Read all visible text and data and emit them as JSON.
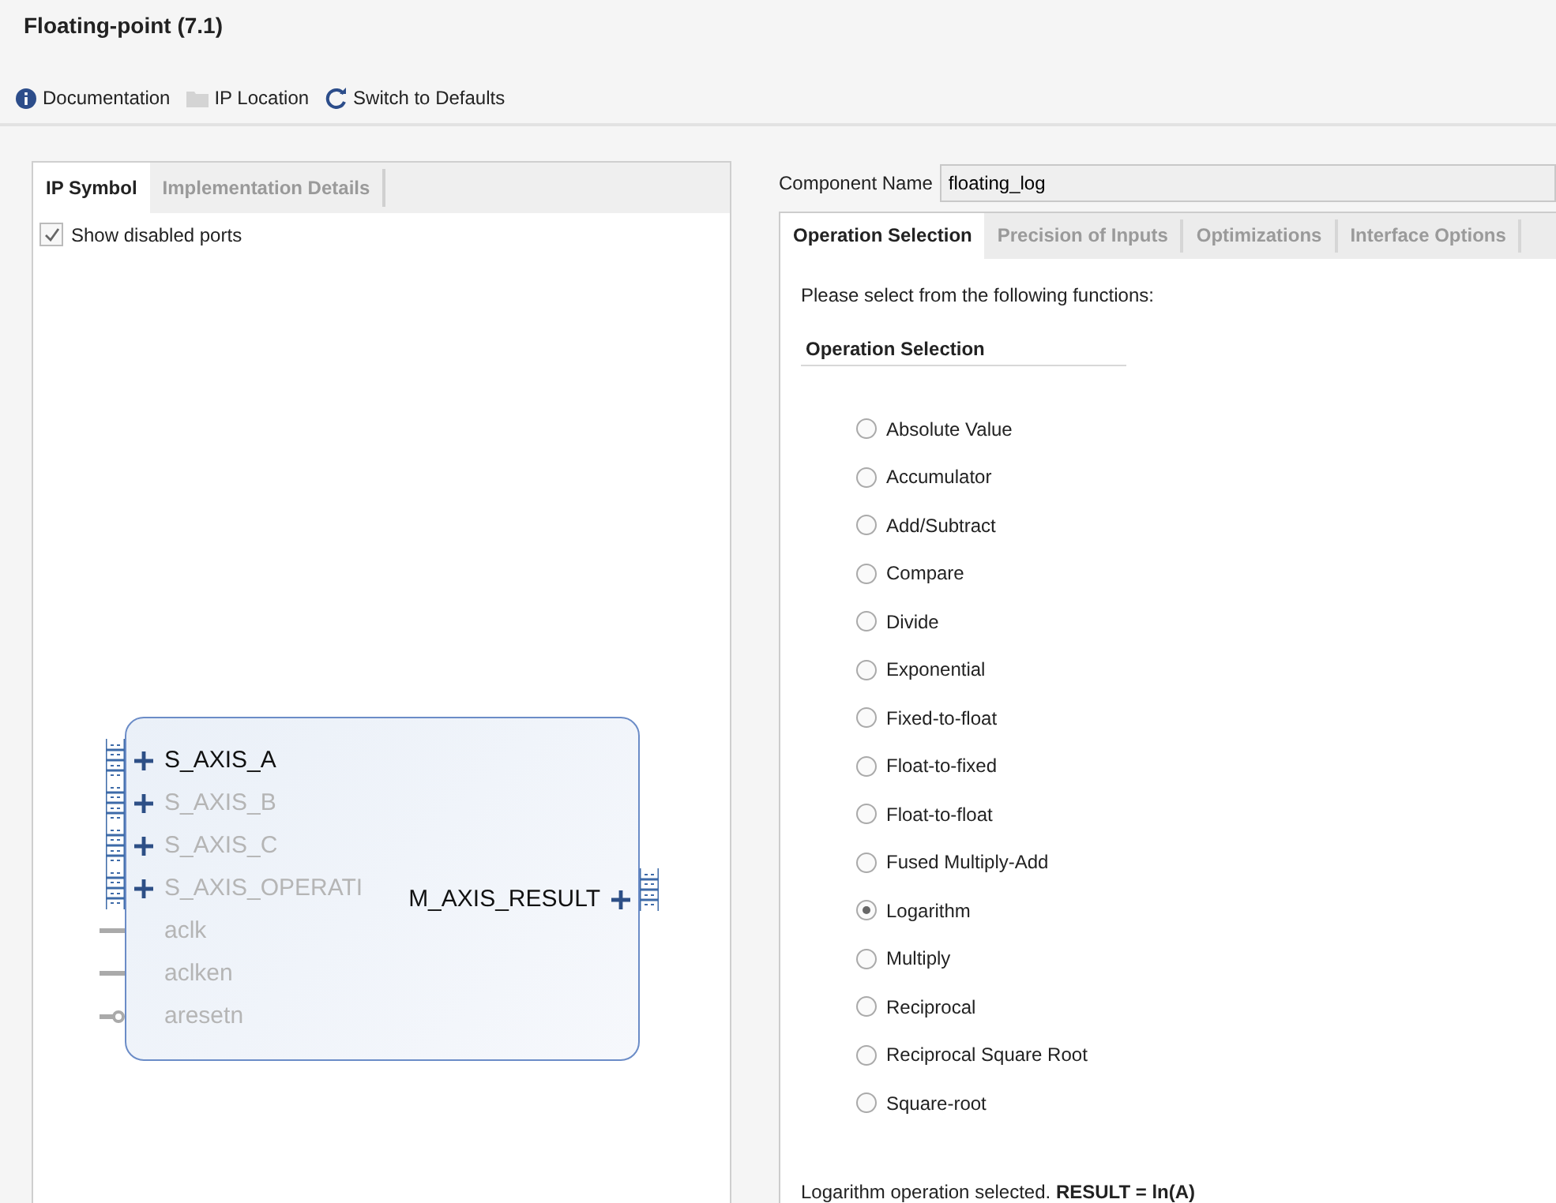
{
  "window": {
    "title": "Floating-point (7.1)"
  },
  "toolbar": [
    {
      "label": "Documentation",
      "kind": "info"
    },
    {
      "label": "IP Location",
      "kind": "folder"
    },
    {
      "label": "Switch to Defaults",
      "kind": "refresh"
    }
  ],
  "left_panel": {
    "tabs": [
      {
        "label": "IP Symbol",
        "selected": true
      },
      {
        "label": "Implementation Details",
        "selected": false
      }
    ],
    "show_disabled_ports": {
      "label": "Show disabled ports",
      "checked": true
    },
    "symbol": {
      "left_ports": [
        {
          "name": "S_AXIS_A",
          "kind": "bus",
          "disabled": false
        },
        {
          "name": "S_AXIS_B",
          "kind": "bus",
          "disabled": true
        },
        {
          "name": "S_AXIS_C",
          "kind": "bus",
          "disabled": true
        },
        {
          "name": "S_AXIS_OPERATI",
          "kind": "bus",
          "disabled": true
        },
        {
          "name": "aclk",
          "kind": "clock",
          "disabled": true
        },
        {
          "name": "aclken",
          "kind": "clock",
          "disabled": true
        },
        {
          "name": "aresetn",
          "kind": "reset",
          "disabled": true
        }
      ],
      "right_ports": [
        {
          "name": "M_AXIS_RESULT",
          "kind": "bus",
          "disabled": false
        }
      ]
    }
  },
  "component_name": {
    "label": "Component Name",
    "value": "floating_log"
  },
  "tabs": [
    {
      "label": "Operation Selection",
      "selected": true
    },
    {
      "label": "Precision of Inputs",
      "selected": false
    },
    {
      "label": "Optimizations",
      "selected": false
    },
    {
      "label": "Interface Options",
      "selected": false
    }
  ],
  "intro": "Please select from the following functions:",
  "section_title": "Operation Selection",
  "operations": [
    {
      "label": "Absolute Value",
      "selected": false
    },
    {
      "label": "Accumulator",
      "selected": false
    },
    {
      "label": "Add/Subtract",
      "selected": false
    },
    {
      "label": "Compare",
      "selected": false
    },
    {
      "label": "Divide",
      "selected": false
    },
    {
      "label": "Exponential",
      "selected": false
    },
    {
      "label": "Fixed-to-float",
      "selected": false
    },
    {
      "label": "Float-to-fixed",
      "selected": false
    },
    {
      "label": "Float-to-float",
      "selected": false
    },
    {
      "label": "Fused Multiply-Add",
      "selected": false
    },
    {
      "label": "Logarithm",
      "selected": true
    },
    {
      "label": "Multiply",
      "selected": false
    },
    {
      "label": "Reciprocal",
      "selected": false
    },
    {
      "label": "Reciprocal Square Root",
      "selected": false
    },
    {
      "label": "Square-root",
      "selected": false
    }
  ],
  "result_note": "Logarithm operation selected. **RESULT = ln(A)**"
}
